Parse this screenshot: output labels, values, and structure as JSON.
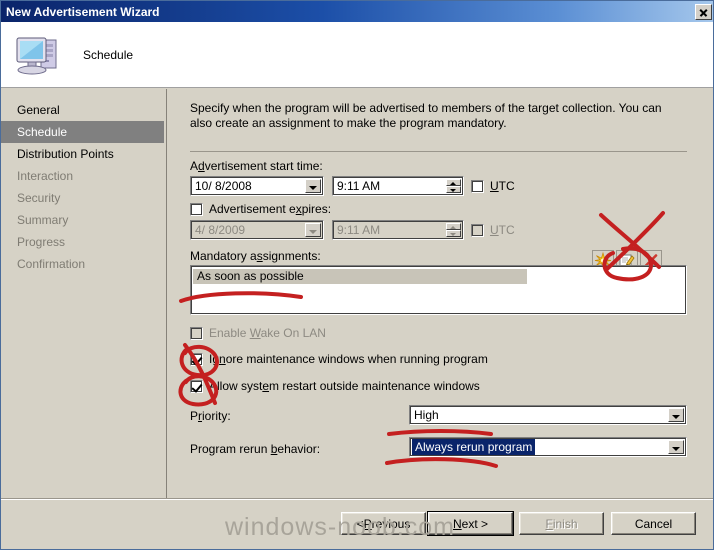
{
  "window": {
    "title": "New Advertisement Wizard",
    "close_label": "x"
  },
  "header": {
    "icon": "computer-icon",
    "title": "Schedule"
  },
  "sidebar": {
    "items": [
      {
        "label": "General",
        "state": "done"
      },
      {
        "label": "Schedule",
        "state": "active"
      },
      {
        "label": "Distribution Points",
        "state": "done"
      },
      {
        "label": "Interaction",
        "state": "pending"
      },
      {
        "label": "Security",
        "state": "pending"
      },
      {
        "label": "Summary",
        "state": "pending"
      },
      {
        "label": "Progress",
        "state": "pending"
      },
      {
        "label": "Confirmation",
        "state": "pending"
      }
    ]
  },
  "main": {
    "intro": "Specify when the program will be advertised to members of the target collection. You can also create an assignment to make the program mandatory.",
    "start_time": {
      "label": "Advertisement start time:",
      "date_value": "10/ 8/2008",
      "time_value": "9:11 AM",
      "utc_label": "UTC",
      "utc_checked": false
    },
    "expires": {
      "label": "Advertisement expires:",
      "checked": false,
      "date_value": "4/ 8/2009",
      "time_value": "9:11 AM",
      "utc_label": "UTC",
      "utc_checked": false
    },
    "mandatory": {
      "label": "Mandatory assignments:",
      "items": [
        {
          "label": "As soon as possible",
          "selected": true
        }
      ],
      "toolbar": [
        {
          "name": "new-assignment-icon",
          "title": "New"
        },
        {
          "name": "edit-assignment-icon",
          "title": "Properties"
        },
        {
          "name": "delete-assignment-icon",
          "title": "Delete"
        }
      ]
    },
    "checkboxes": [
      {
        "label": "Enable Wake On LAN",
        "checked": false,
        "enabled": false,
        "accel": "W"
      },
      {
        "label": "Ignore maintenance windows when running program",
        "checked": true,
        "enabled": true,
        "accel": "n"
      },
      {
        "label": "Allow system restart outside maintenance windows",
        "checked": true,
        "enabled": true,
        "accel": "e"
      }
    ],
    "priority": {
      "label": "Priority:",
      "value": "High"
    },
    "rerun": {
      "label": "Program rerun behavior:",
      "value": "Always rerun program",
      "focused": true
    }
  },
  "footer": {
    "buttons": [
      {
        "label": "< Previous",
        "state": "normal"
      },
      {
        "label": "Next >",
        "state": "default"
      },
      {
        "label": "Finish",
        "state": "disabled"
      },
      {
        "label": "Cancel",
        "state": "normal"
      }
    ]
  },
  "watermark": {
    "text": "windows-noob.com"
  },
  "annotations": {
    "color": "#c42020",
    "marks": [
      "x-over-new-icon",
      "circle-around-new-icon",
      "underline-under-list-item",
      "circle-around-ignore-checkbox",
      "circle-around-allow-checkbox",
      "underline-under-priority-value",
      "underline-under-rerun-value"
    ]
  }
}
